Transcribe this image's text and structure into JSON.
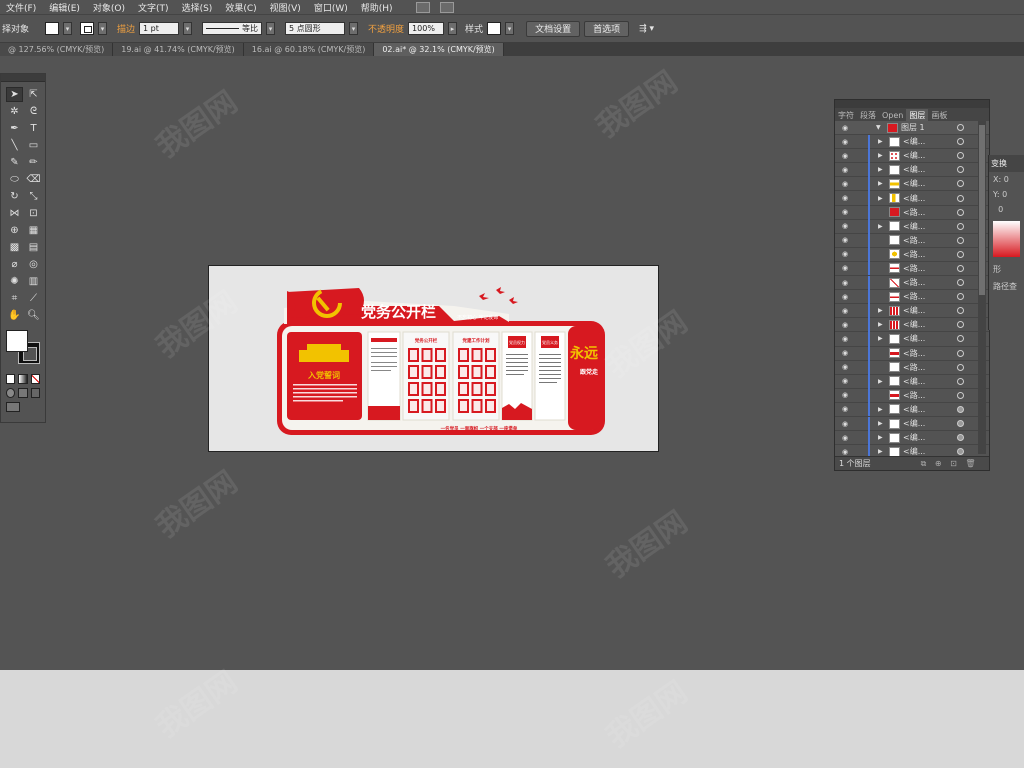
{
  "menubar": {
    "items": [
      "文件(F)",
      "编辑(E)",
      "对象(O)",
      "文字(T)",
      "选择(S)",
      "效果(C)",
      "视图(V)",
      "窗口(W)",
      "帮助(H)"
    ]
  },
  "controlbar": {
    "selection_label": "择对象",
    "stroke_label": "描边",
    "stroke_weight": "1 pt",
    "stroke_profile": "等比",
    "brush": "5 点圆形",
    "opacity_label": "不透明度",
    "opacity_value": "100%",
    "style_label": "样式",
    "doc_setup_button": "文档设置",
    "preferences_button": "首选项"
  },
  "tabs": [
    {
      "label": "@ 127.56% (CMYK/预览)",
      "active": false
    },
    {
      "label": "19.ai @ 41.74% (CMYK/预览)",
      "active": false
    },
    {
      "label": "16.ai @ 60.18% (CMYK/预览)",
      "active": false
    },
    {
      "label": "02.ai* @ 32.1% (CMYK/预览)",
      "active": true
    }
  ],
  "artboard": {
    "title": "党务公开栏",
    "slogan_top": "不忘初心 牢记使命",
    "oath_title": "入党誓词",
    "panel1_header": "党务公开栏",
    "panel2_header": "党建工作计划",
    "panel3_header": "党员权力",
    "panel4_header": "党员义务",
    "vertical_text": "永远",
    "vertical_sub": "跟党走",
    "footer_text": "一名党员 一面旗帜 一个支部 一座堡垒"
  },
  "layers_panel": {
    "tabs": [
      "字符",
      "段落",
      "Open",
      "图层",
      "画板"
    ],
    "active_tab": "图层",
    "top_layer": "图层 1",
    "rows": [
      {
        "name": "<编...",
        "expand": true,
        "thumb": "white",
        "target": "empty"
      },
      {
        "name": "<编...",
        "expand": true,
        "thumb": "red-dots",
        "target": "empty"
      },
      {
        "name": "<编...",
        "expand": true,
        "thumb": "white",
        "target": "empty"
      },
      {
        "name": "<编...",
        "expand": true,
        "thumb": "yellow",
        "target": "empty"
      },
      {
        "name": "<编...",
        "expand": true,
        "thumb": "yellow-small",
        "target": "empty"
      },
      {
        "name": "<路...",
        "expand": false,
        "thumb": "red",
        "target": "empty"
      },
      {
        "name": "<编...",
        "expand": true,
        "thumb": "white",
        "target": "empty"
      },
      {
        "name": "<路...",
        "expand": false,
        "thumb": "white",
        "target": "empty"
      },
      {
        "name": "<路...",
        "expand": false,
        "thumb": "yellow-emblem",
        "target": "empty"
      },
      {
        "name": "<路...",
        "expand": false,
        "thumb": "red-line",
        "target": "empty"
      },
      {
        "name": "<路...",
        "expand": false,
        "thumb": "red-diag",
        "target": "empty"
      },
      {
        "name": "<路...",
        "expand": false,
        "thumb": "red-line",
        "target": "empty"
      },
      {
        "name": "<编...",
        "expand": true,
        "thumb": "red-grid",
        "target": "empty"
      },
      {
        "name": "<编...",
        "expand": true,
        "thumb": "red-grid",
        "target": "empty"
      },
      {
        "name": "<编...",
        "expand": true,
        "thumb": "white",
        "target": "empty"
      },
      {
        "name": "<路...",
        "expand": false,
        "thumb": "red-band",
        "target": "empty"
      },
      {
        "name": "<路...",
        "expand": false,
        "thumb": "white",
        "target": "empty"
      },
      {
        "name": "<编...",
        "expand": true,
        "thumb": "white",
        "target": "empty"
      },
      {
        "name": "<路...",
        "expand": false,
        "thumb": "red-band",
        "target": "empty"
      },
      {
        "name": "<编...",
        "expand": true,
        "thumb": "white",
        "target": "filled"
      },
      {
        "name": "<编...",
        "expand": true,
        "thumb": "white",
        "target": "filled"
      },
      {
        "name": "<编...",
        "expand": true,
        "thumb": "white",
        "target": "filled"
      },
      {
        "name": "<编...",
        "expand": true,
        "thumb": "white",
        "target": "filled"
      }
    ],
    "footer": "1 个图层"
  },
  "side_panel": {
    "tab": "变换",
    "label_shape": "形",
    "label_path": "路径查"
  },
  "watermark": "我图网",
  "colors": {
    "party_red": "#d71920",
    "gold": "#f2c200",
    "canvas": "#545454",
    "panel": "#535353"
  }
}
